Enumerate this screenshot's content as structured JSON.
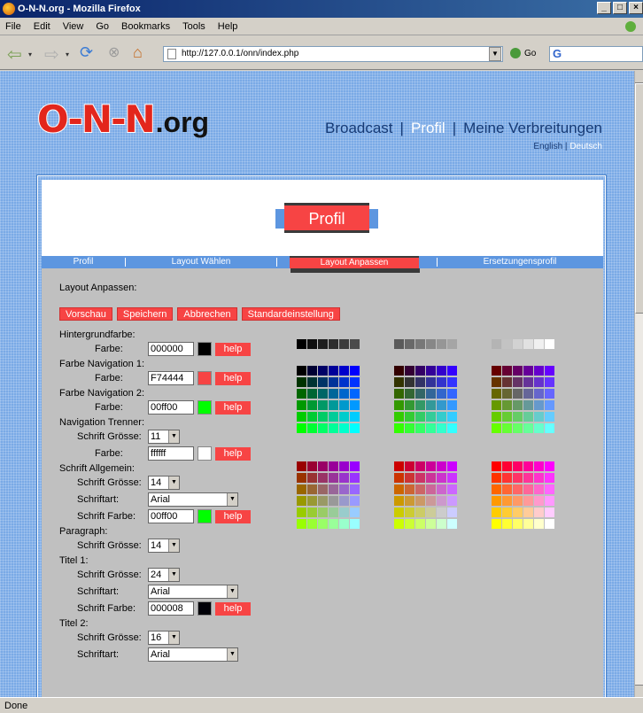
{
  "window": {
    "title": "O-N-N.org - Mozilla Firefox"
  },
  "menu": [
    "File",
    "Edit",
    "View",
    "Go",
    "Bookmarks",
    "Tools",
    "Help"
  ],
  "navbar": {
    "url": "http://127.0.0.1/onn/index.php",
    "go_label": "Go",
    "search_logo": "G"
  },
  "status": "Done",
  "site": {
    "logo_text": "O-N-N",
    "logo_suffix": ".org",
    "nav": [
      "Broadcast",
      "Profil",
      "Meine Verbreitungen"
    ],
    "nav_active": "Profil",
    "lang": [
      "English",
      "Deutsch"
    ],
    "lang_active": "Deutsch"
  },
  "page": {
    "title": "Profil",
    "tabs": [
      "Profil",
      "Layout Wählen",
      "Layout Anpassen",
      "Ersetzungensprofil"
    ],
    "active_tab": "Layout Anpassen",
    "section_title": "Layout Anpassen:",
    "actions": [
      "Vorschau",
      "Speichern",
      "Abbrechen",
      "Standardeinstellung"
    ]
  },
  "form": {
    "help_label": "help",
    "groups": [
      {
        "label": "Hintergrundfarbe:",
        "fields": [
          {
            "type": "color",
            "label": "Farbe:",
            "value": "000000",
            "swatch": "#000000"
          }
        ]
      },
      {
        "label": "Farbe Navigation 1:",
        "fields": [
          {
            "type": "color",
            "label": "Farbe:",
            "value": "F74444",
            "swatch": "#f74444"
          }
        ]
      },
      {
        "label": "Farbe Navigation 2:",
        "fields": [
          {
            "type": "color",
            "label": "Farbe:",
            "value": "00ff00",
            "swatch": "#00ff00"
          }
        ]
      },
      {
        "label": "Navigation Trenner:",
        "fields": [
          {
            "type": "size",
            "label": "Schrift Grösse:",
            "value": "11"
          },
          {
            "type": "color",
            "label": "Farbe:",
            "value": "ffffff",
            "swatch": "#ffffff"
          }
        ]
      },
      {
        "label": "Schrift Allgemein:",
        "fields": [
          {
            "type": "size",
            "label": "Schrift Grösse:",
            "value": "14"
          },
          {
            "type": "font",
            "label": "Schriftart:",
            "value": "Arial"
          },
          {
            "type": "color",
            "label": "Schrift Farbe:",
            "value": "00ff00",
            "swatch": "#00ff00"
          }
        ]
      },
      {
        "label": "Paragraph:",
        "fields": [
          {
            "type": "size",
            "label": "Schrift Grösse:",
            "value": "14"
          }
        ]
      },
      {
        "label": "Titel 1:",
        "fields": [
          {
            "type": "size",
            "label": "Schrift Grösse:",
            "value": "24"
          },
          {
            "type": "font",
            "label": "Schriftart:",
            "value": "Arial"
          },
          {
            "type": "color",
            "label": "Schrift Farbe:",
            "value": "000008",
            "swatch": "#000008"
          }
        ]
      },
      {
        "label": "Titel 2:",
        "fields": [
          {
            "type": "size",
            "label": "Schrift Grösse:",
            "value": "16"
          },
          {
            "type": "font",
            "label": "Schriftart:",
            "value": "Arial"
          }
        ]
      }
    ]
  },
  "colors": {
    "accent": "#f74444",
    "nav_blue": "#5d96e0",
    "panel_grey": "#c0c0c0",
    "page_bg": "#7aaae6",
    "nav_text": "#163a75"
  }
}
